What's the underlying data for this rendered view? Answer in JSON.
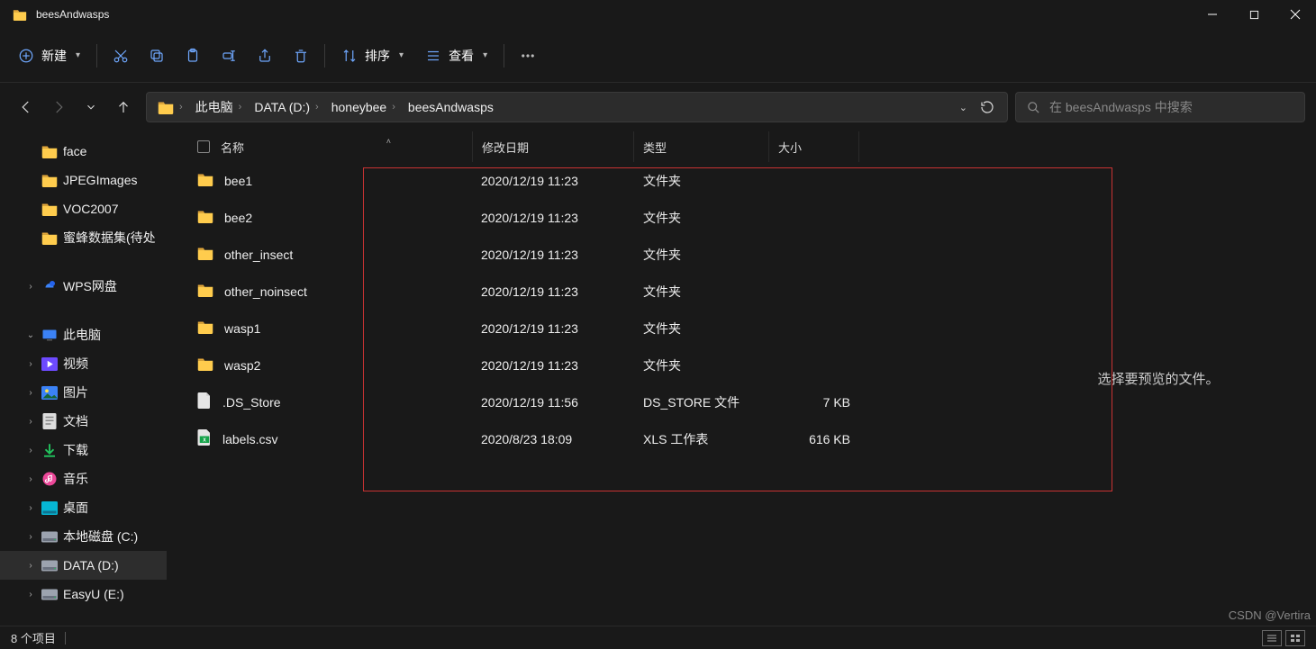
{
  "window": {
    "title": "beesAndwasps"
  },
  "toolbar": {
    "new_label": "新建",
    "sort_label": "排序",
    "view_label": "查看"
  },
  "breadcrumb": [
    "此电脑",
    "DATA (D:)",
    "honeybee",
    "beesAndwasps"
  ],
  "search": {
    "placeholder": "在 beesAndwasps 中搜索"
  },
  "columns": {
    "name": "名称",
    "date": "修改日期",
    "type": "类型",
    "size": "大小"
  },
  "sidebar": {
    "items": [
      {
        "label": "face",
        "icon": "folder",
        "indent": 2
      },
      {
        "label": "JPEGImages",
        "icon": "folder",
        "indent": 2
      },
      {
        "label": "VOC2007",
        "icon": "folder",
        "indent": 2
      },
      {
        "label": "蜜蜂数据集(待处",
        "icon": "folder",
        "indent": 2
      },
      {
        "label": "WPS网盘",
        "icon": "wps",
        "indent": 1,
        "chevron": ">"
      },
      {
        "label": "此电脑",
        "icon": "pc",
        "indent": 1,
        "chevron": "v"
      },
      {
        "label": "视频",
        "icon": "video",
        "indent": 2,
        "chevron": ">"
      },
      {
        "label": "图片",
        "icon": "pic",
        "indent": 2,
        "chevron": ">"
      },
      {
        "label": "文档",
        "icon": "doc",
        "indent": 2,
        "chevron": ">"
      },
      {
        "label": "下载",
        "icon": "dl",
        "indent": 2,
        "chevron": ">"
      },
      {
        "label": "音乐",
        "icon": "music",
        "indent": 2,
        "chevron": ">"
      },
      {
        "label": "桌面",
        "icon": "desk",
        "indent": 2,
        "chevron": ">"
      },
      {
        "label": "本地磁盘 (C:)",
        "icon": "drive",
        "indent": 2,
        "chevron": ">"
      },
      {
        "label": "DATA (D:)",
        "icon": "drive",
        "indent": 2,
        "chevron": ">",
        "selected": true
      },
      {
        "label": "EasyU (E:)",
        "icon": "drive",
        "indent": 2,
        "chevron": ">"
      }
    ]
  },
  "files": [
    {
      "name": "bee1",
      "date": "2020/12/19 11:23",
      "type": "文件夹",
      "size": "",
      "icon": "folder"
    },
    {
      "name": "bee2",
      "date": "2020/12/19 11:23",
      "type": "文件夹",
      "size": "",
      "icon": "folder"
    },
    {
      "name": "other_insect",
      "date": "2020/12/19 11:23",
      "type": "文件夹",
      "size": "",
      "icon": "folder"
    },
    {
      "name": "other_noinsect",
      "date": "2020/12/19 11:23",
      "type": "文件夹",
      "size": "",
      "icon": "folder"
    },
    {
      "name": "wasp1",
      "date": "2020/12/19 11:23",
      "type": "文件夹",
      "size": "",
      "icon": "folder"
    },
    {
      "name": "wasp2",
      "date": "2020/12/19 11:23",
      "type": "文件夹",
      "size": "",
      "icon": "folder"
    },
    {
      "name": ".DS_Store",
      "date": "2020/12/19 11:56",
      "type": "DS_STORE 文件",
      "size": "7 KB",
      "icon": "file"
    },
    {
      "name": "labels.csv",
      "date": "2020/8/23 18:09",
      "type": "XLS 工作表",
      "size": "616 KB",
      "icon": "xls"
    }
  ],
  "preview": {
    "empty_text": "选择要预览的文件。"
  },
  "status": {
    "count_text": "8 个项目"
  },
  "watermark": "CSDN @Vertira"
}
